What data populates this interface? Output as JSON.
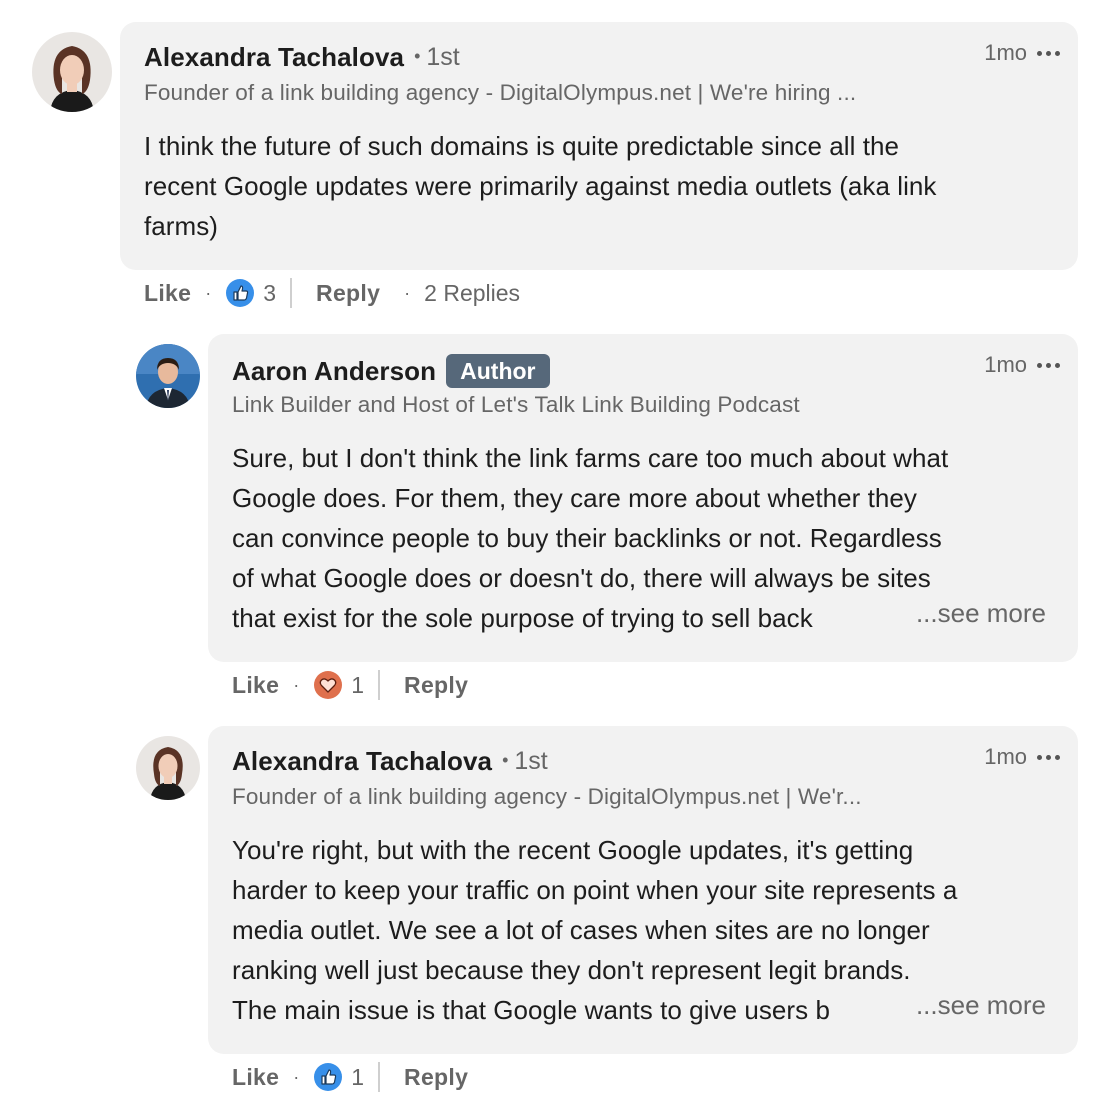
{
  "comments": [
    {
      "author": "Alexandra Tachalova",
      "degree": "1st",
      "headline": "Founder of a link building agency - DigitalOlympus.net | We're hiring ...",
      "time": "1mo",
      "body": "I think the future of such domains is quite predictable since all the\nrecent Google updates were primarily against media outlets (aka link\nfarms)",
      "like_label": "Like",
      "reaction": "like-icon",
      "reaction_count": "3",
      "reply_label": "Reply",
      "replies_label": "2 Replies"
    },
    {
      "author": "Aaron Anderson",
      "badge": "Author",
      "headline": "Link Builder and Host of Let's Talk Link Building Podcast",
      "time": "1mo",
      "body": "Sure, but I don't think the link farms care too much about what\nGoogle does. For them, they care more about whether they\ncan convince people to buy their backlinks or not. Regardless\nof what Google does or doesn't do, there will always be sites\nthat exist for the sole purpose of trying to sell back",
      "see_more": "...see more",
      "like_label": "Like",
      "reaction": "love-icon",
      "reaction_count": "1",
      "reply_label": "Reply"
    },
    {
      "author": "Alexandra Tachalova",
      "degree": "1st",
      "headline": "Founder of a link building agency - DigitalOlympus.net | We'r...",
      "time": "1mo",
      "body": "You're right, but with the recent Google updates, it's getting\nharder to keep your traffic on point when your site represents a\nmedia outlet. We see a lot of cases when sites are no longer\nranking well just because they don't represent legit brands.\nThe main issue is that Google wants to give users b",
      "see_more": "...see more",
      "like_label": "Like",
      "reaction": "like-icon",
      "reaction_count": "1",
      "reply_label": "Reply"
    }
  ],
  "colors": {
    "bubble": "#f2f2f2",
    "secondary_text": "#666666",
    "badge_bg": "#56687a",
    "like_blue": "#378fe9",
    "love_red": "#df704d"
  }
}
